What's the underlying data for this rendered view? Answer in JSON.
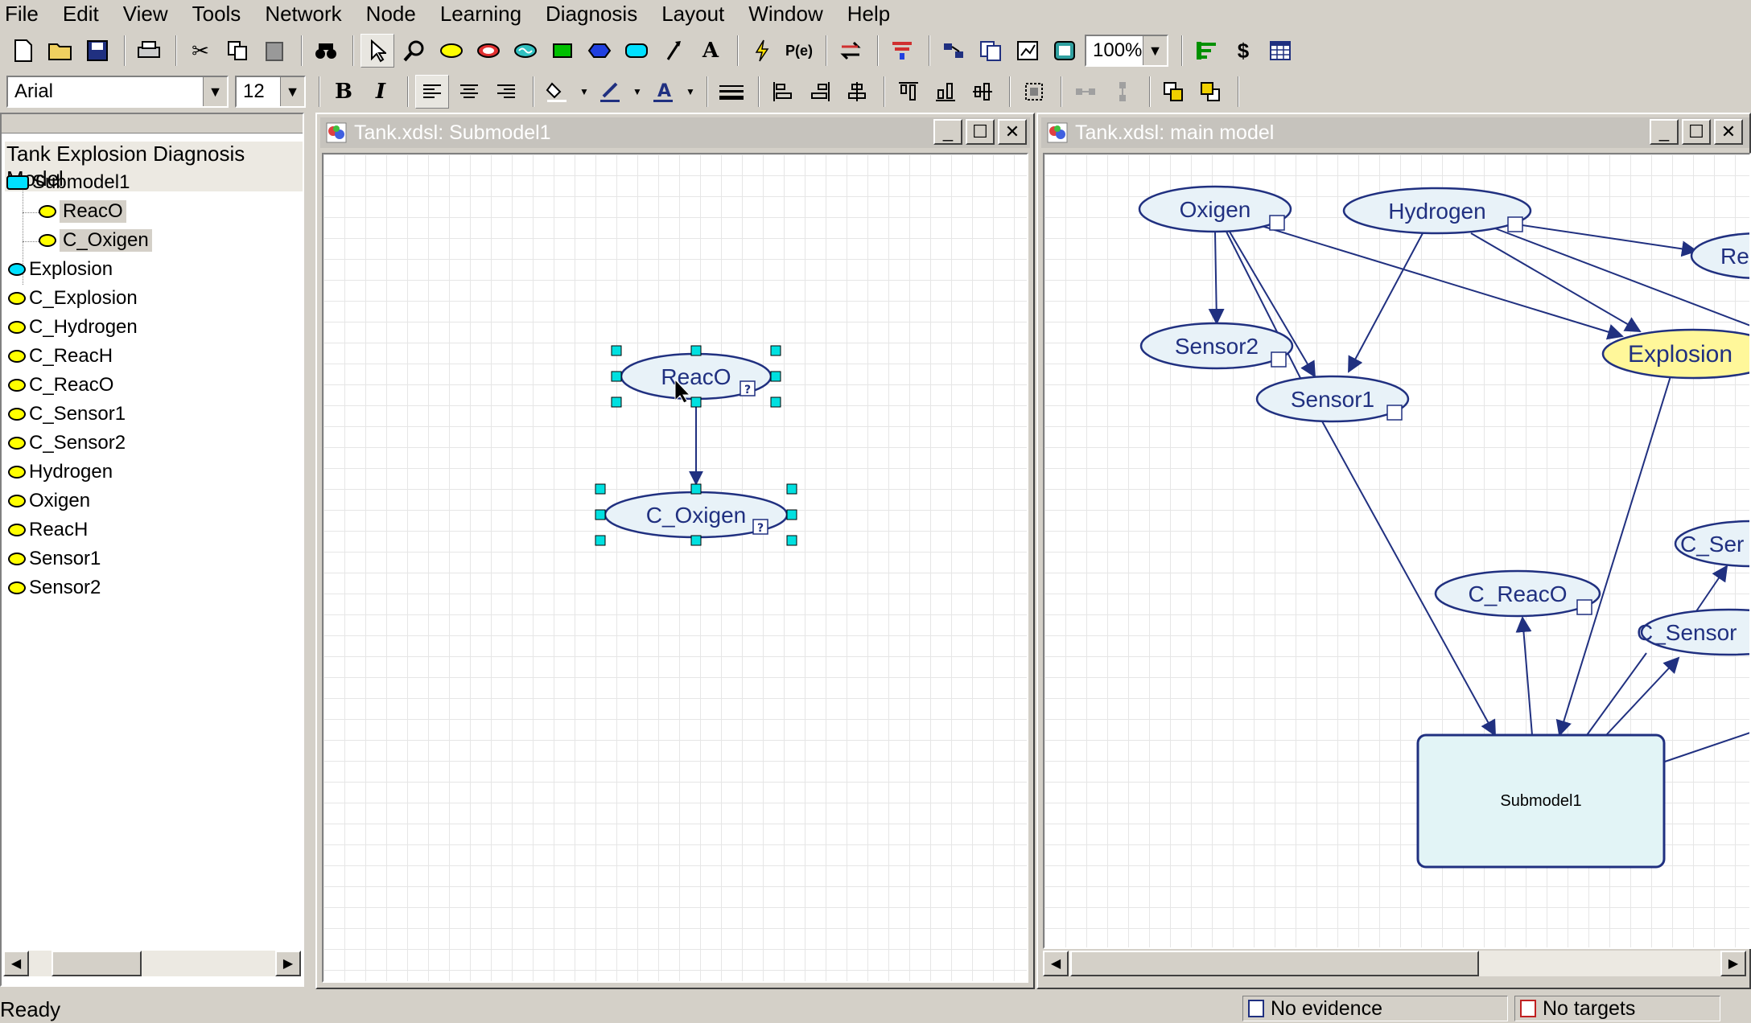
{
  "menu": [
    "File",
    "Edit",
    "View",
    "Tools",
    "Network",
    "Node",
    "Learning",
    "Diagnosis",
    "Layout",
    "Window",
    "Help"
  ],
  "toolbar": {
    "zoom": "100%",
    "font_name": "Arial",
    "font_size": "12"
  },
  "tree": {
    "title": "Tank Explosion Diagnosis Model",
    "submodel": "Submodel1",
    "children": [
      "ReacO",
      "C_Oxigen"
    ],
    "items": [
      "Explosion",
      "C_Explosion",
      "C_Hydrogen",
      "C_ReacH",
      "C_ReacO",
      "C_Sensor1",
      "C_Sensor2",
      "Hydrogen",
      "Oxigen",
      "ReacH",
      "Sensor1",
      "Sensor2"
    ]
  },
  "win_sub": {
    "title": "Tank.xdsl: Submodel1",
    "nodes": {
      "reaco": "ReacO",
      "coxigen": "C_Oxigen"
    }
  },
  "win_main": {
    "title": "Tank.xdsl: main model",
    "nodes": {
      "oxigen": "Oxigen",
      "hydrogen": "Hydrogen",
      "re": "Re",
      "sensor2": "Sensor2",
      "sensor1": "Sensor1",
      "explosion": "Explosion",
      "cser": "C_Ser",
      "creaco": "C_ReacO",
      "csensor": "C_Sensor",
      "submodel": "Submodel1"
    }
  },
  "status": {
    "text": "Ready",
    "evidence": "No evidence",
    "targets": "No targets"
  },
  "colors": {
    "node_fill": "#e8f2f8",
    "node_stroke": "#203080",
    "explosion_fill": "#fff79a",
    "submodel_fill": "#e2f4f6",
    "handle": "#00e0e0",
    "title_inactive": "#c6c3bd"
  }
}
